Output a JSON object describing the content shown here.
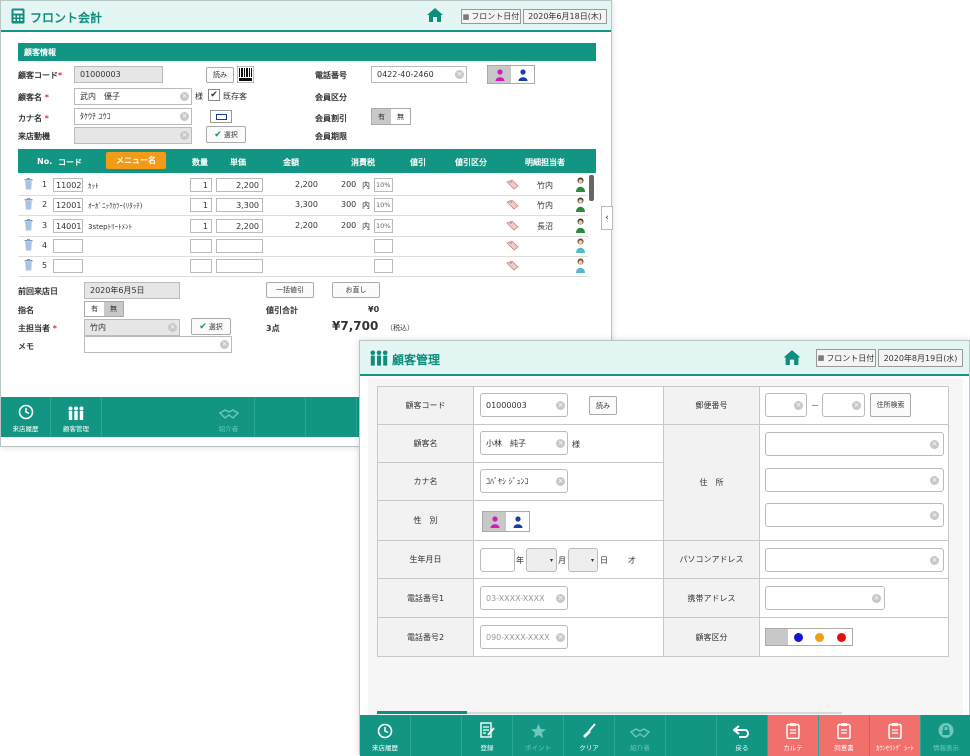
{
  "w1": {
    "title": "フロント会計",
    "front_date_label": "フロント日付",
    "date": "2020年6月18日(木)",
    "section": "顧客情報",
    "customer_code_label": "顧客コード",
    "customer_code": "01000003",
    "read_btn": "読み",
    "phone_label": "電話番号",
    "phone": "0422-40-2460",
    "name_label": "顧客名",
    "name": "武内　優子",
    "honorific": "様",
    "existing": "既存客",
    "member_class_label": "会員区分",
    "kana_label": "カナ名",
    "kana": "ﾀｹｳﾁ ﾕｳｺ",
    "member_disc_label": "会員割引",
    "yes": "有",
    "no": "無",
    "visit_reason_label": "来店動機",
    "select_btn": "選択",
    "member_period_label": "会員期限",
    "cols": [
      "No.",
      "コード",
      "メニュー名",
      "数量",
      "単価",
      "金額",
      "消費税",
      "値引",
      "値引区分",
      "明細担当者"
    ],
    "rows": [
      {
        "no": "1",
        "code": "11002",
        "name": "ｶｯﾄ",
        "qty": "1",
        "price": "2,200",
        "amount": "2,200",
        "tax": "200",
        "taxtype": "内",
        "rate": "10%",
        "staff": "竹内"
      },
      {
        "no": "2",
        "code": "12001",
        "name": "ｵｰｶﾞﾆｯｸｶﾗｰ(ﾘﾀｯﾁ)",
        "qty": "1",
        "price": "3,300",
        "amount": "3,300",
        "tax": "300",
        "taxtype": "内",
        "rate": "10%",
        "staff": "竹内"
      },
      {
        "no": "3",
        "code": "14001",
        "name": "3stepﾄﾘｰﾄﾒﾝﾄ",
        "qty": "1",
        "price": "2,200",
        "amount": "2,200",
        "tax": "200",
        "taxtype": "内",
        "rate": "10%",
        "staff": "長沼"
      },
      {
        "no": "4"
      },
      {
        "no": "5"
      }
    ],
    "last_visit_label": "前回来店日",
    "last_visit": "2020年6月5日",
    "bulk_discount": "一括値引",
    "change_btn": "お直し",
    "designation_label": "指名",
    "discount_total_label": "値引合計",
    "discount_total": "¥0",
    "main_staff_label": "主担当者",
    "main_staff": "竹内",
    "count": "3点",
    "total": "¥7,700",
    "tax_incl": "（税込）",
    "memo_label": "メモ",
    "footer": [
      "来店履歴",
      "顧客管理",
      "紹介者"
    ]
  },
  "w2": {
    "title": "顧客管理",
    "front_date_label": "フロント日付",
    "date": "2020年8月19日(水)",
    "customer_code_label": "顧客コード",
    "customer_code": "01000003",
    "read_btn": "読み",
    "postal_label": "郵便番号",
    "dash": "－",
    "addr_search": "住所検索",
    "name_label": "顧客名",
    "name": "小林　純子",
    "honorific": "様",
    "kana_label": "カナ名",
    "kana": "ｺﾊﾞﾔｼ ｼﾞｭﾝｺ",
    "address_label": "住　所",
    "gender_label": "性　別",
    "birthday_label": "生年月日",
    "year": "年",
    "month": "月",
    "day": "日",
    "age": "才",
    "pc_label": "パソコンアドレス",
    "phone1_label": "電話番号1",
    "phone1_ph": "03-XXXX-XXXX",
    "mobile_label": "携帯アドレス",
    "phone2_label": "電話番号2",
    "phone2_ph": "090-XXXX-XXXX",
    "class_label": "顧客区分",
    "class_colors": [
      "#1515d8",
      "#f0a010",
      "#e01010"
    ],
    "footer": [
      "来店履歴",
      "登録",
      "ポイント",
      "クリア",
      "紹介者",
      "戻る",
      "カルテ",
      "同意書",
      "ｶｳﾝｾﾘﾝｸﾞ ｼｰﾄ",
      "情報表示"
    ]
  }
}
